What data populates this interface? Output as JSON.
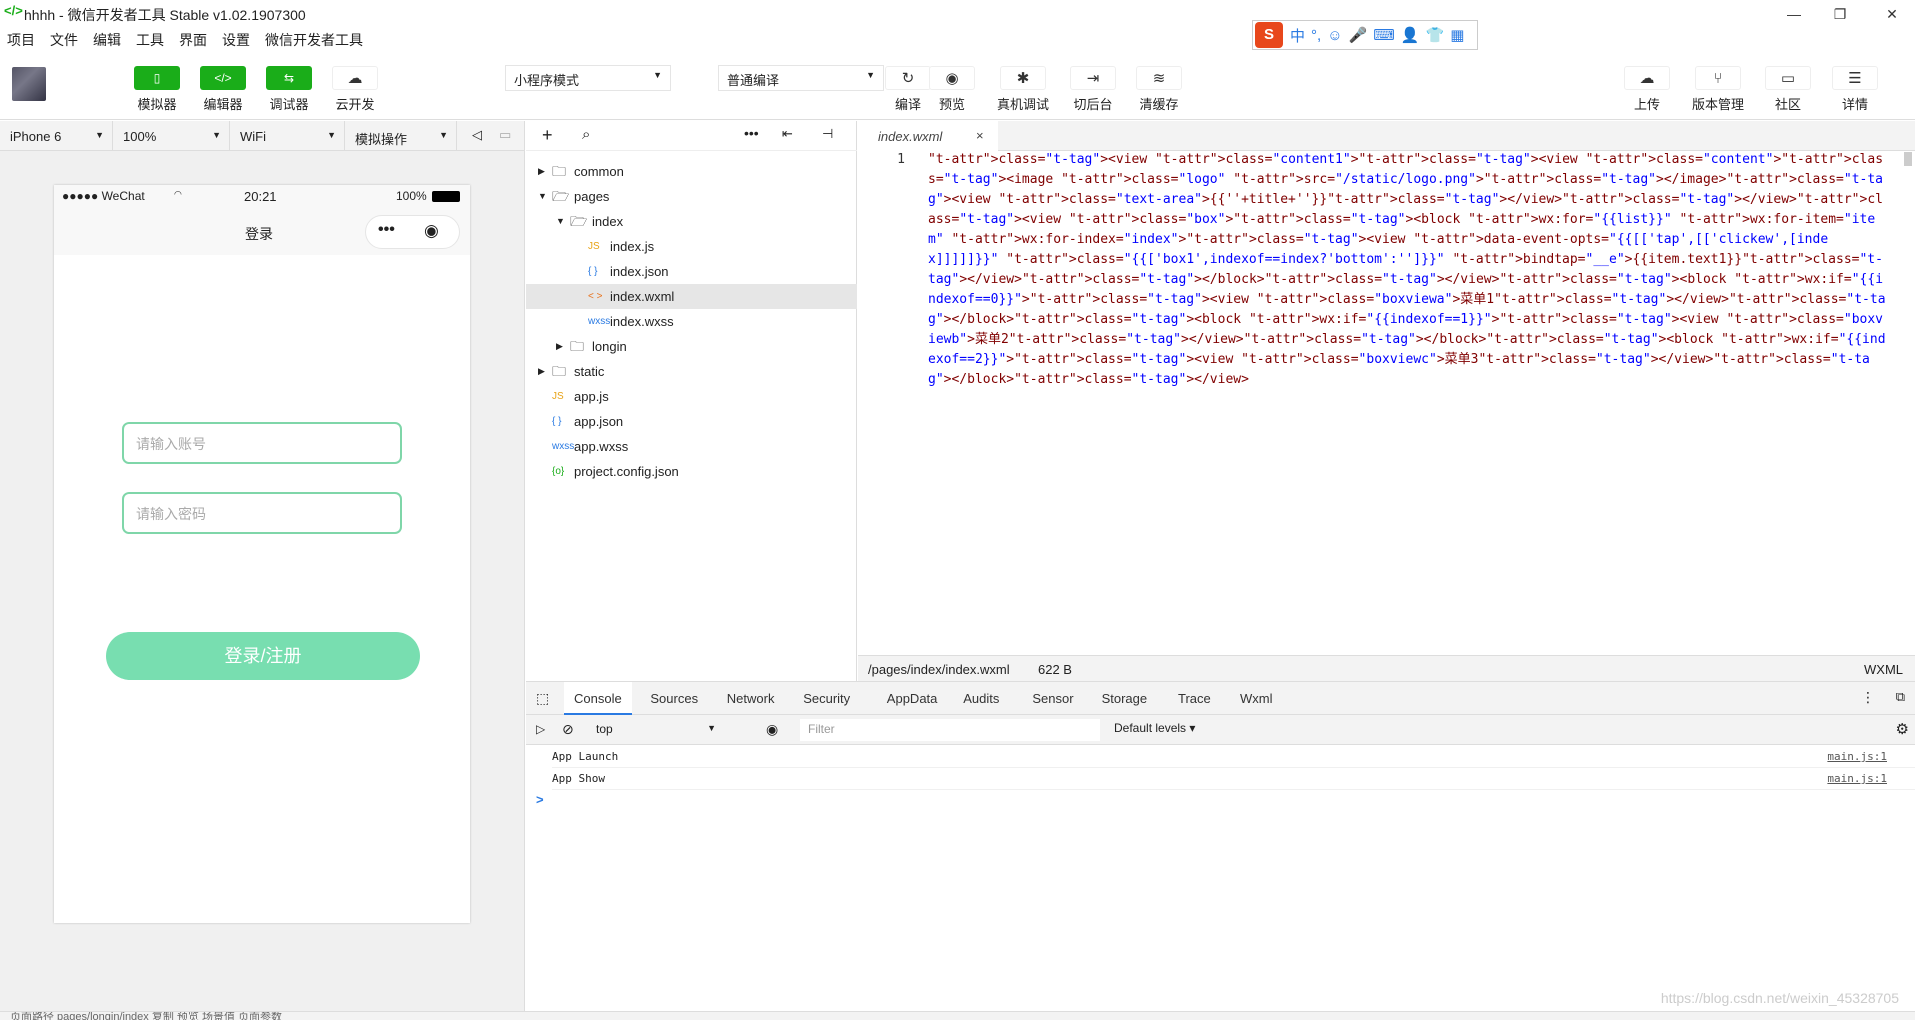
{
  "window": {
    "title": "hhhh - 微信开发者工具 Stable v1.02.1907300",
    "logo": "</>"
  },
  "menu": [
    "项目",
    "文件",
    "编辑",
    "工具",
    "界面",
    "设置",
    "微信开发者工具"
  ],
  "ime": {
    "items": [
      "S",
      "中",
      "°,",
      "☺",
      "🎤",
      "⌨",
      "👤",
      "👕",
      "▦"
    ]
  },
  "toolbar": {
    "left": [
      {
        "label": "模拟器",
        "icon": "phone-icon"
      },
      {
        "label": "编辑器",
        "icon": "code-icon"
      },
      {
        "label": "调试器",
        "icon": "debug-icon"
      },
      {
        "label": "云开发",
        "icon": "cloud-icon"
      }
    ],
    "mode": "小程序模式",
    "compile": "普通编译",
    "middle": [
      {
        "label": "编译",
        "icon": "↻"
      },
      {
        "label": "预览",
        "icon": "◉"
      },
      {
        "label": "真机调试",
        "icon": "✱"
      },
      {
        "label": "切后台",
        "icon": "⇥"
      },
      {
        "label": "清缓存",
        "icon": "≋"
      }
    ],
    "right": [
      {
        "label": "上传",
        "icon": "☁"
      },
      {
        "label": "版本管理",
        "icon": "⑂"
      },
      {
        "label": "社区",
        "icon": "▭"
      },
      {
        "label": "详情",
        "icon": "☰"
      }
    ]
  },
  "simbar": {
    "device": "iPhone 6",
    "zoom": "100%",
    "network": "WiFi",
    "op": "模拟操作"
  },
  "phone": {
    "signal": "●●●●● WeChat",
    "time": "20:21",
    "battery": "100%",
    "navtitle": "登录",
    "capsule_dots": "•••",
    "account_placeholder": "请输入账号",
    "password_placeholder": "请输入密码",
    "login_label": "登录/注册"
  },
  "files": [
    {
      "name": "common",
      "type": "folder",
      "open": false,
      "depth": 0
    },
    {
      "name": "pages",
      "type": "folder",
      "open": true,
      "depth": 0
    },
    {
      "name": "index",
      "type": "folder",
      "open": true,
      "depth": 1
    },
    {
      "name": "index.js",
      "type": "js",
      "depth": 2
    },
    {
      "name": "index.json",
      "type": "json",
      "depth": 2
    },
    {
      "name": "index.wxml",
      "type": "wxml",
      "depth": 2,
      "selected": true
    },
    {
      "name": "index.wxss",
      "type": "wxss",
      "depth": 2
    },
    {
      "name": "longin",
      "type": "folder",
      "open": false,
      "depth": 1
    },
    {
      "name": "static",
      "type": "folder",
      "open": false,
      "depth": 0
    },
    {
      "name": "app.js",
      "type": "js",
      "depth": 0
    },
    {
      "name": "app.json",
      "type": "json",
      "depth": 0
    },
    {
      "name": "app.wxss",
      "type": "wxss",
      "depth": 0
    },
    {
      "name": "project.config.json",
      "type": "config",
      "depth": 0
    }
  ],
  "editor": {
    "tab": "index.wxml",
    "line_number": "1",
    "code": "<view class=\"content1\"><view class=\"content\"><image class=\"logo\" src=\"/static/logo.png\"></image><view class=\"text-area\">{{''+title+''}}</view></view><view class=\"box\"><block wx:for=\"{{list}}\" wx:for-item=\"item\" wx:for-index=\"index\"><view data-event-opts=\"{{[['tap',[['clickew',[index]]]]]}}\" class=\"{{['box1',indexof==index?'bottom':'']}}\" bindtap=\"__e\">{{item.text1}}</view></block></view><block wx:if=\"{{indexof==0}}\"><view class=\"boxviewa\">菜单1</view></block><block wx:if=\"{{indexof==1}}\"><view class=\"boxviewb\">菜单2</view></block><block wx:if=\"{{indexof==2}}\"><view class=\"boxviewc\">菜单3</view></block></view>",
    "path": "/pages/index/index.wxml",
    "size": "622 B",
    "lang": "WXML"
  },
  "devtools": {
    "tabs": [
      "Console",
      "Sources",
      "Network",
      "Security",
      "AppData",
      "Audits",
      "Sensor",
      "Storage",
      "Trace",
      "Wxml"
    ],
    "active": "Console",
    "context": "top",
    "filter_placeholder": "Filter",
    "levels": "Default levels",
    "logs": [
      {
        "text": "App Launch",
        "src": "main.js:1"
      },
      {
        "text": "App Show",
        "src": "main.js:1"
      }
    ],
    "prompt": ">"
  },
  "statusbar": {
    "text": "页面路径  pages/longin/index  复制  预览     场景值     页面参数"
  },
  "watermark": "https://blog.csdn.net/weixin_45328705"
}
